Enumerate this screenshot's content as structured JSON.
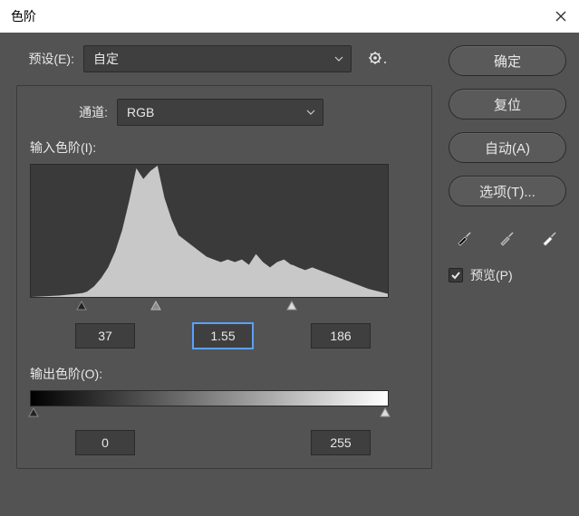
{
  "window": {
    "title": "色阶"
  },
  "preset": {
    "label": "预设(E):",
    "value": "自定"
  },
  "channel": {
    "label": "通道:",
    "value": "RGB"
  },
  "input_levels": {
    "label": "输入色阶(I):",
    "shadow": "37",
    "midtone": "1.55",
    "highlight": "186"
  },
  "output_levels": {
    "label": "输出色阶(O):",
    "black": "0",
    "white": "255"
  },
  "buttons": {
    "ok": "确定",
    "reset": "复位",
    "auto": "自动(A)",
    "options": "选项(T)..."
  },
  "preview": {
    "label": "预览(P)",
    "checked": true
  },
  "chart_data": {
    "type": "area",
    "title": "",
    "xlabel": "",
    "ylabel": "",
    "xlim": [
      0,
      255
    ],
    "ylim": [
      0,
      100
    ],
    "x": [
      0,
      20,
      30,
      37,
      40,
      45,
      50,
      55,
      60,
      65,
      70,
      75,
      80,
      85,
      90,
      95,
      100,
      105,
      110,
      115,
      120,
      125,
      130,
      135,
      140,
      145,
      150,
      155,
      160,
      165,
      170,
      175,
      180,
      185,
      186,
      190,
      195,
      200,
      210,
      220,
      230,
      240,
      255
    ],
    "values": [
      0,
      1,
      2,
      3,
      4,
      8,
      14,
      22,
      34,
      50,
      72,
      96,
      88,
      94,
      98,
      74,
      58,
      46,
      42,
      38,
      34,
      30,
      28,
      26,
      28,
      26,
      28,
      24,
      32,
      26,
      22,
      26,
      28,
      24,
      24,
      22,
      20,
      22,
      18,
      14,
      10,
      6,
      2
    ]
  }
}
